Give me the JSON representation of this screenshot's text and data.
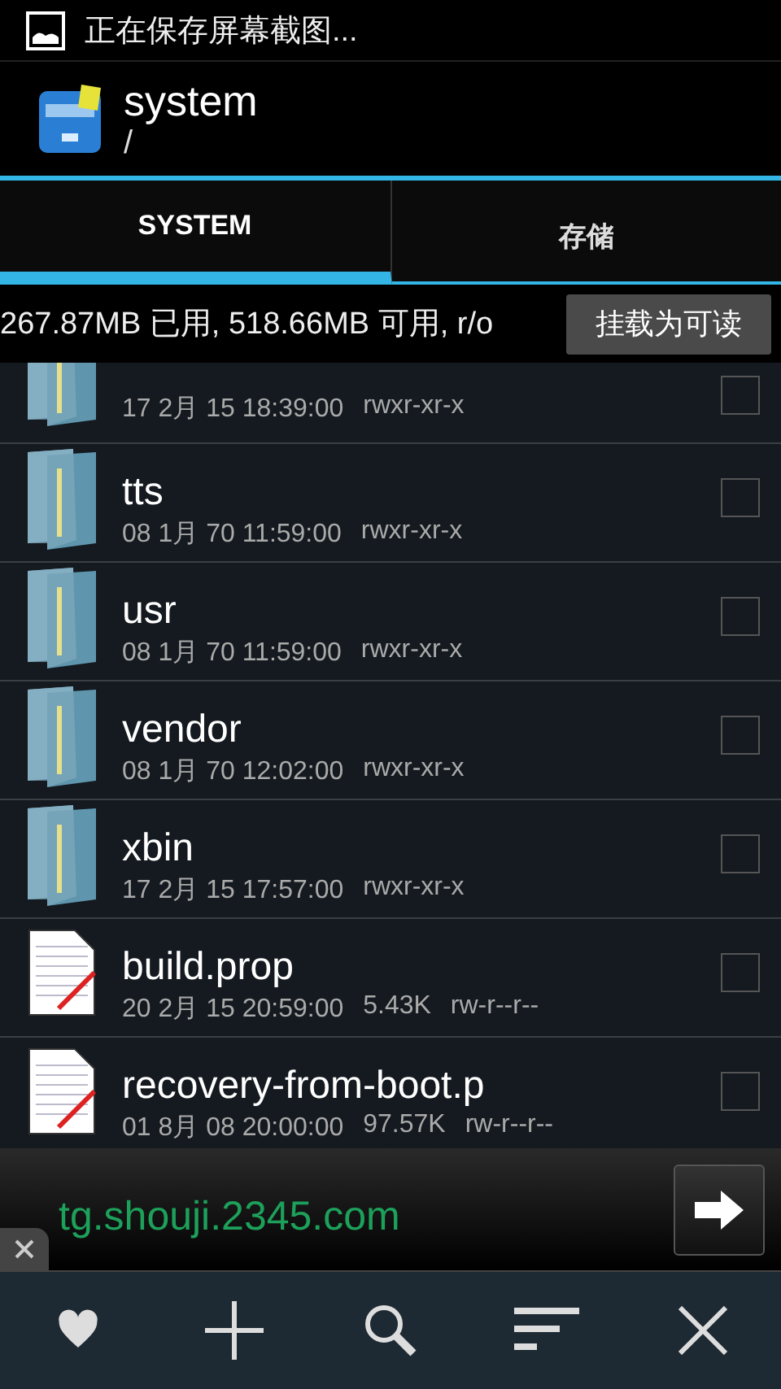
{
  "status_bar": {
    "notification": "正在保存屏幕截图..."
  },
  "header": {
    "title": "system",
    "path": "/"
  },
  "tabs": [
    {
      "label": "SYSTEM",
      "selected": true
    },
    {
      "label": "存储",
      "selected": false
    }
  ],
  "storage_info": {
    "text": "267.87MB 已用, 518.66MB 可用, r/o",
    "button": "挂载为可读"
  },
  "files": [
    {
      "kind": "folder",
      "date": "17 2月 15 18:39:00",
      "permissions": "rwxr-xr-x",
      "checked": false
    },
    {
      "kind": "folder",
      "name": "tts",
      "date": "08 1月 70 11:59:00",
      "permissions": "rwxr-xr-x",
      "checked": false
    },
    {
      "kind": "folder",
      "name": "usr",
      "date": "08 1月 70 11:59:00",
      "permissions": "rwxr-xr-x",
      "checked": false
    },
    {
      "kind": "folder",
      "name": "vendor",
      "date": "08 1月 70 12:02:00",
      "permissions": "rwxr-xr-x",
      "checked": false
    },
    {
      "kind": "folder",
      "name": "xbin",
      "date": "17 2月 15 17:57:00",
      "permissions": "rwxr-xr-x",
      "checked": false
    },
    {
      "kind": "file",
      "name": "build.prop",
      "date": "20 2月 15 20:59:00",
      "size": "5.43K",
      "permissions": "rw-r--r--",
      "checked": false
    },
    {
      "kind": "file",
      "name": "recovery-from-boot.p",
      "date": "01 8月 08 20:00:00",
      "size": "97.57K",
      "permissions": "rw-r--r--",
      "checked": false
    }
  ],
  "ad_banner": {
    "url": "tg.shouji.2345.com"
  },
  "toolbar": [
    {
      "kind": "favorite"
    },
    {
      "kind": "add"
    },
    {
      "kind": "search"
    },
    {
      "kind": "sort"
    },
    {
      "kind": "close"
    }
  ]
}
